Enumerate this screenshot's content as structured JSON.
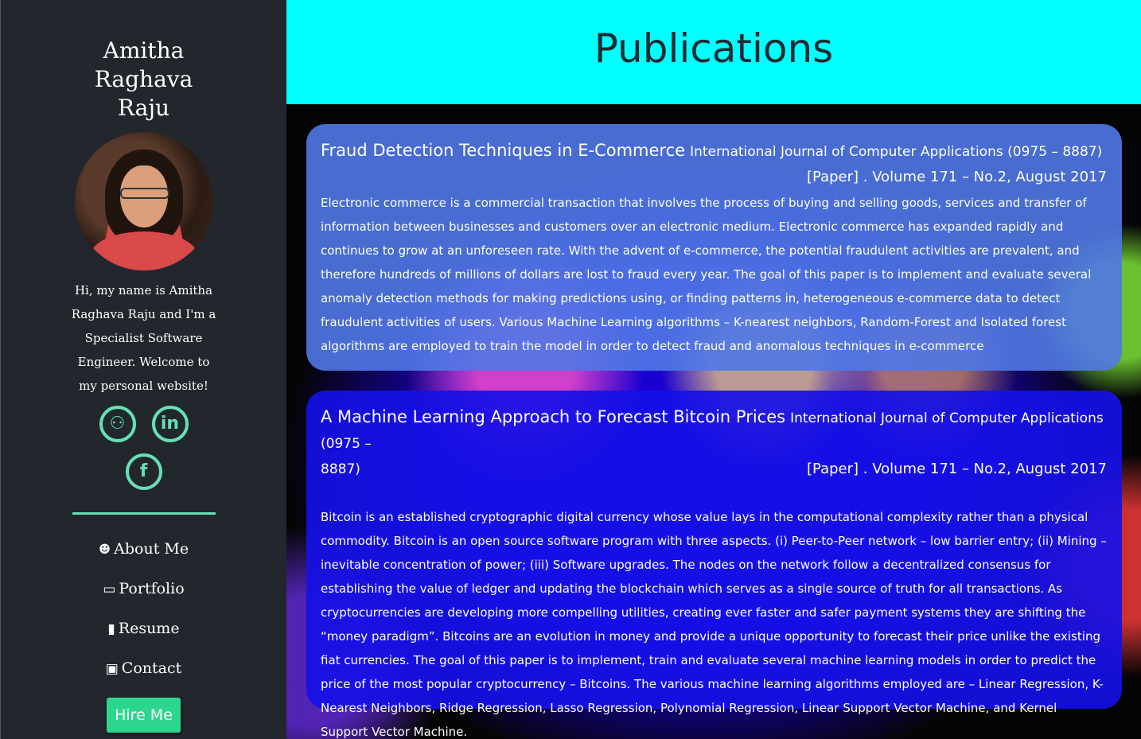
{
  "sidebar": {
    "name": "Amitha Raghava Raju",
    "intro": "Hi, my name is Amitha Raghava Raju and I'm a Specialist Software Engineer. Welcome to my personal website!",
    "socials": [
      {
        "name": "github",
        "glyph": "⚇"
      },
      {
        "name": "linkedin",
        "glyph": "in"
      },
      {
        "name": "facebook",
        "glyph": "f"
      }
    ],
    "nav": [
      {
        "label": "About Me",
        "icon": "user-icon"
      },
      {
        "label": "Portfolio",
        "icon": "laptop-icon"
      },
      {
        "label": "Resume",
        "icon": "file-icon"
      },
      {
        "label": "Contact",
        "icon": "contact-card-icon"
      }
    ],
    "hire_label": "Hire Me",
    "accent": "#67e0b6"
  },
  "header": {
    "title": "Publications"
  },
  "publications": [
    {
      "title": "Fraud Detection Techniques in E-Commerce",
      "journal": "International Journal of Computer Applications (0975 – 8887)",
      "ref": "[Paper] . Volume 171 – No.2, August 2017",
      "abstract": "Electronic commerce is a commercial transaction that involves the process of buying and selling goods, services and transfer of information between businesses and customers over an electronic medium. Electronic commerce has expanded rapidly and continues to grow at an unforeseen rate. With the advent of e-commerce, the potential fraudulent activities are prevalent, and therefore hundreds of millions of dollars are lost to fraud every year. The goal of this paper is to implement and evaluate several anomaly detection methods for making predictions using, or finding patterns in, heterogeneous e-commerce data to detect fraudulent activities of users. Various Machine Learning algorithms – K-nearest neighbors, Random-Forest and Isolated forest algorithms are employed to train the model in order to detect fraud and anomalous techniques in e-commerce"
    },
    {
      "title": "A Machine Learning Approach to Forecast Bitcoin Prices",
      "journal": "International Journal of Computer Applications (0975 –",
      "journal_cont": "8887)",
      "ref": "[Paper] . Volume 171 – No.2, August 2017",
      "abstract": "Bitcoin is an established cryptographic digital currency whose value lays in the computational complexity rather than a physical commodity. Bitcoin is an open source software program with three aspects. (i) Peer-to-Peer network – low barrier entry; (ii) Mining – inevitable concentration of power; (iii) Software upgrades. The nodes on the network follow a decentralized consensus for establishing the value of ledger and updating the blockchain which serves as a single source of truth for all transactions. As cryptocurrencies are developing more compelling utilities, creating ever faster and safer payment systems they are shifting the “money paradigm”. Bitcoins are an evolution in money and provide a unique opportunity to forecast their price unlike the existing fiat currencies. The goal of this paper is to implement, train and evaluate several machine learning models in order to predict the price of the most popular cryptocurrency – Bitcoins. The various machine learning algorithms employed are – Linear Regression, K-Nearest Neighbors, Ridge Regression, Lasso Regression, Polynomial Regression, Linear Support Vector Machine, and Kernel Support Vector Machine."
    }
  ]
}
